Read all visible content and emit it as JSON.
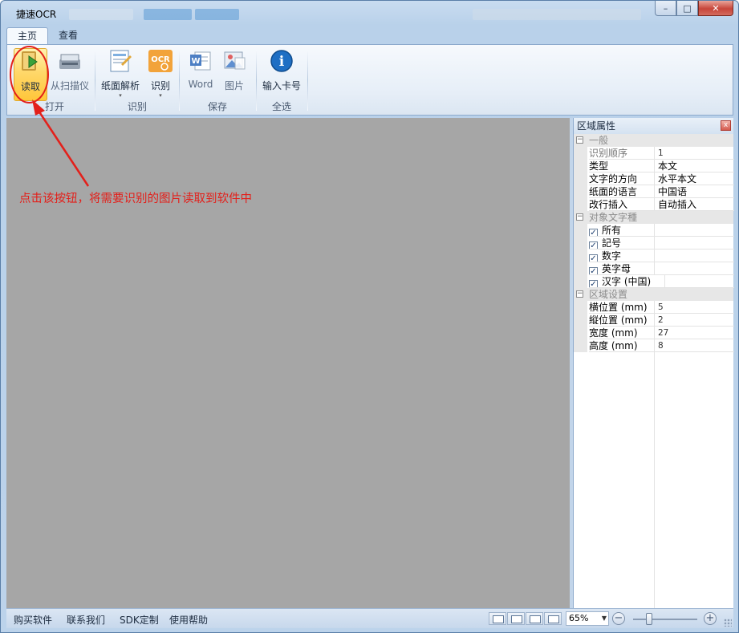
{
  "window": {
    "title": "捷速OCR",
    "controls": {
      "minimize": "–",
      "maximize": "□",
      "close": "✕"
    }
  },
  "ribbon": {
    "tabs": [
      {
        "label": "主页",
        "active": true
      },
      {
        "label": "查看",
        "active": false
      }
    ],
    "groups": {
      "open": {
        "label": "打开",
        "buttons": [
          {
            "label": "读取",
            "icon": "read-icon"
          },
          {
            "label": "从扫描仪",
            "icon": "scanner-icon"
          }
        ]
      },
      "recognize": {
        "label": "识别",
        "buttons": [
          {
            "label": "纸面解析",
            "icon": "layout-analysis-icon",
            "dropdown": "▾"
          },
          {
            "label": "识别",
            "icon": "ocr-icon",
            "dropdown": "▾",
            "icon_text": "OCR"
          }
        ]
      },
      "save": {
        "label": "保存",
        "buttons": [
          {
            "label": "Word",
            "icon": "word-icon",
            "icon_text": "W"
          },
          {
            "label": "图片",
            "icon": "image-icon"
          }
        ]
      },
      "selectall": {
        "label": "全选",
        "buttons": [
          {
            "label": "输入卡号",
            "icon": "info-icon",
            "icon_text": "i"
          }
        ]
      }
    }
  },
  "annotation": {
    "text": "点击该按钮，将需要识别的图片读取到软件中",
    "color": "#e3201b"
  },
  "panel": {
    "title": "区域属性",
    "close": "x",
    "sections": [
      {
        "name": "一般",
        "toggle": "⊟",
        "rows": [
          {
            "key": "识别顺序",
            "value": "1",
            "muted": true,
            "small": true
          },
          {
            "key": "类型",
            "value": "本文"
          },
          {
            "key": "文字的方向",
            "value": "水平本文"
          },
          {
            "key": "纸面的语言",
            "value": "中国语"
          },
          {
            "key": "改行插入",
            "value": "自动插入"
          }
        ]
      },
      {
        "name": "对象文字種",
        "toggle": "⊟",
        "checks": [
          {
            "label": "所有",
            "checked": true
          },
          {
            "label": "記号",
            "checked": true
          },
          {
            "label": "数字",
            "checked": true
          },
          {
            "label": "英字母",
            "checked": true
          },
          {
            "label": "汉字 (中国)",
            "checked": true
          }
        ]
      },
      {
        "name": "区域设置",
        "toggle": "⊟",
        "rows": [
          {
            "key": "横位置 (mm)",
            "value": "5",
            "small": true
          },
          {
            "key": "縦位置 (mm)",
            "value": "2",
            "small": true
          },
          {
            "key": "宽度 (mm)",
            "value": "27",
            "small": true
          },
          {
            "key": "高度 (mm)",
            "value": "8",
            "small": true
          }
        ]
      }
    ]
  },
  "statusbar": {
    "links": [
      "购买软件",
      "联系我们",
      "SDK定制",
      "使用帮助"
    ],
    "zoom": "65%",
    "zoom_level": 0.25,
    "zoom_out": "−",
    "zoom_in": "+"
  },
  "colors": {
    "canvas": "#a6a6a6",
    "accent": "#e3201b",
    "ribbon_highlight": "#ffd86a"
  }
}
